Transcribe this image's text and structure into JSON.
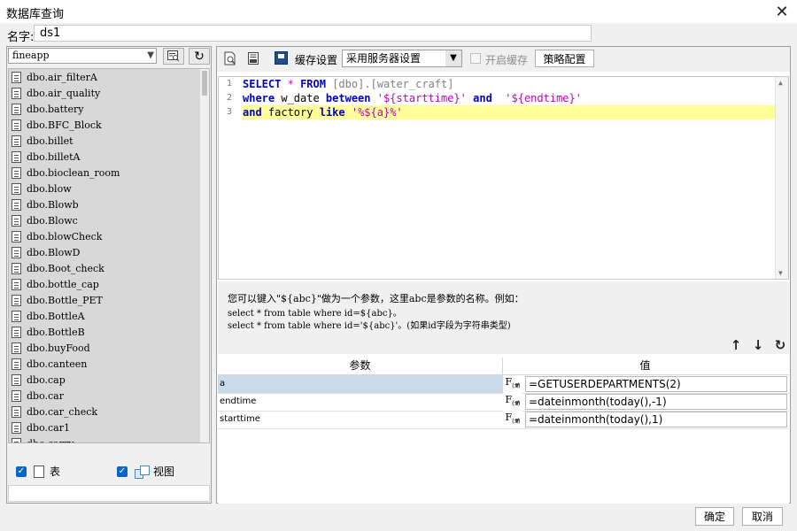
{
  "window": {
    "title": "数据库查询",
    "close_glyph": "✕"
  },
  "name_row": {
    "label": "名字:",
    "value": "ds1"
  },
  "left": {
    "database": "fineapp",
    "tables": [
      "dbo.air_filterA",
      "dbo.air_quality",
      "dbo.battery",
      "dbo.BFC_Block",
      "dbo.billet",
      "dbo.billetA",
      "dbo.bioclean_room",
      "dbo.blow",
      "dbo.Blowb",
      "dbo.Blowc",
      "dbo.blowCheck",
      "dbo.BlowD",
      "dbo.Boot_check",
      "dbo.bottle_cap",
      "dbo.Bottle_PET",
      "dbo.BottleA",
      "dbo.BottleB",
      "dbo.buyFood",
      "dbo.canteen",
      "dbo.cap",
      "dbo.car",
      "dbo.car_check",
      "dbo.car1",
      "dbo.carry"
    ],
    "show_table_label": "表",
    "show_view_label": "视图"
  },
  "toolbar": {
    "cache_label": "缓存设置",
    "cache_option": "采用服务器设置",
    "enable_cache_label": "开启缓存",
    "strategy_label": "策略配置"
  },
  "editor": {
    "line_numbers": [
      "1",
      "2",
      "3"
    ]
  },
  "hint": {
    "line1": "您可以键入\"${abc}\"做为一个参数，这里abc是参数的名称。例如：",
    "line2": "select * from table where id=${abc}。",
    "line3": "select * from table where id='${abc}'。(如果id字段为字符串类型)"
  },
  "params": {
    "header_param": "参数",
    "header_value": "值",
    "rows": [
      {
        "name": "a",
        "value": "=GETUSERDEPARTMENTS(2)",
        "selected": true
      },
      {
        "name": "endtime",
        "value": "=dateinmonth(today(),-1)",
        "selected": false
      },
      {
        "name": "starttime",
        "value": "=dateinmonth(today(),1)",
        "selected": false
      }
    ]
  },
  "footer": {
    "ok": "确定",
    "cancel": "取消"
  },
  "colors": {
    "keyword": "#0000cc",
    "string": "#c000c0",
    "highlight": "#ffff99",
    "selected_row": "#c9dbea",
    "checkbox": "#0a66c2"
  }
}
